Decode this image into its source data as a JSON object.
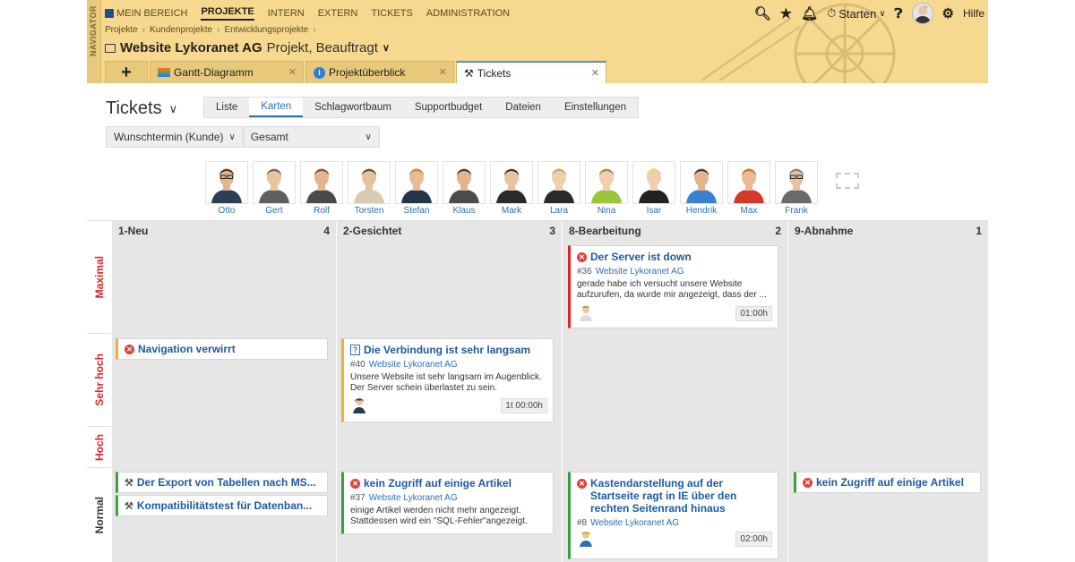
{
  "navigator_label": "NAVIGATOR",
  "topnav": [
    {
      "label": "MEIN BEREICH"
    },
    {
      "label": "PROJEKTE"
    },
    {
      "label": "INTERN"
    },
    {
      "label": "EXTERN"
    },
    {
      "label": "TICKETS"
    },
    {
      "label": "ADMINISTRATION"
    }
  ],
  "top_right": {
    "starten_label": "Starten",
    "help_label": "Hilfe"
  },
  "breadcrumb": [
    "Projekte",
    "Kundenprojekte",
    "Entwicklungsprojekte"
  ],
  "project": {
    "name": "Website Lykoranet AG",
    "status": "Projekt, Beauftragt"
  },
  "tabs": [
    {
      "label": "Gantt-Diagramm",
      "icon": "gantt-chart-icon"
    },
    {
      "label": "Projektüberblick",
      "icon": "info-icon"
    },
    {
      "label": "Tickets",
      "icon": "tools-icon"
    }
  ],
  "page_title": "Tickets",
  "view_tabs": [
    "Liste",
    "Karten",
    "Schlagwortbaum",
    "Supportbudget",
    "Dateien",
    "Einstellungen"
  ],
  "filters": {
    "date_filter": "Wunschtermin (Kunde)",
    "scope_filter": "Gesamt"
  },
  "people": [
    "Otto",
    "Gert",
    "Rolf",
    "Torsten",
    "Stefan",
    "Klaus",
    "Mark",
    "Lara",
    "Nina",
    "Isar",
    "Hendrik",
    "Max",
    "Frank"
  ],
  "priorities": [
    {
      "label": "Maximal",
      "color": "#d62828"
    },
    {
      "label": "Sehr hoch",
      "color": "#d62828"
    },
    {
      "label": "Hoch",
      "color": "#d62828"
    },
    {
      "label": "Normal",
      "color": "#333333"
    }
  ],
  "columns": [
    {
      "title": "1-Neu",
      "count": "4"
    },
    {
      "title": "2-Gesichtet",
      "count": "3"
    },
    {
      "title": "8-Bearbeitung",
      "count": "2"
    },
    {
      "title": "9-Abnahme",
      "count": "1"
    }
  ],
  "cards": {
    "c36": {
      "title": "Der Server ist down",
      "id": "#36",
      "project": "Website Lykoranet AG",
      "desc": "gerade habe ich versucht unsere Website aufzurufen, da wurde mir angezeigt, dass der ...",
      "time": "01:00h"
    },
    "c_nav": {
      "title": "Navigation verwirrt"
    },
    "c40": {
      "title": "Die Verbindung ist sehr langsam",
      "id": "#40",
      "project": "Website Lykoranet AG",
      "desc": "Unsere Website ist sehr langsam im Augenblick. Der Server schein überlastet zu sein.",
      "time": "1t 00:00h"
    },
    "c_export": {
      "title": "Der Export von Tabellen nach MS..."
    },
    "c_kompat": {
      "title": "Kompatibilitätstest für Datenban..."
    },
    "c37": {
      "title": "kein Zugriff auf einige Artikel",
      "id": "#37",
      "project": "Website Lykoranet AG",
      "desc": "einige Artikel werden nicht mehr angezeigt. Stattdessen wird ein \"SQL-Fehler\"angezeigt."
    },
    "c8": {
      "title": "Kastendarstellung auf der Startseite ragt in IE über den rechten Seitenrand hinaus",
      "id": "#8",
      "project": "Website Lykoranet AG",
      "time": "02:00h"
    },
    "c_abn": {
      "title": "kein Zugriff auf einige Artikel"
    }
  }
}
